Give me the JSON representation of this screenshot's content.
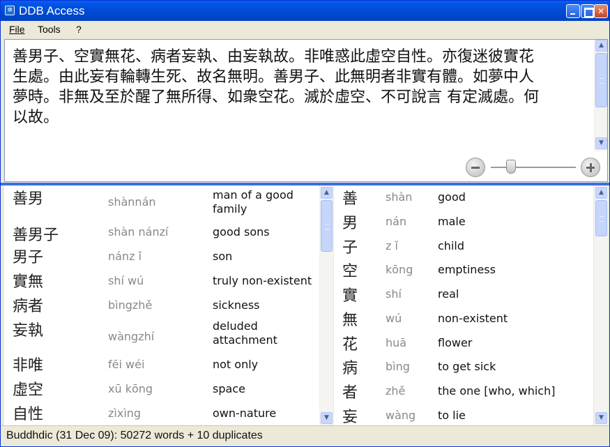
{
  "window": {
    "title": "DDB Access"
  },
  "menu": {
    "file": "File",
    "tools": "Tools",
    "help": "?"
  },
  "text_panel": {
    "lines": [
      "善男子、空實無花、病者妄執、由妄執故。非唯惑此虛空自性。亦復迷彼實花",
      "生處。由此妄有輪轉生死、故名無明。善男子、此無明者非實有體。如夢中人",
      "夢時。非無及至於醒了無所得、如衆空花。滅於虛空、不可說言  有定滅處。何",
      "以故。"
    ]
  },
  "zoom": {
    "level": 0.2
  },
  "left_list": [
    {
      "word": "善男",
      "pinyin": "shànnán",
      "english": "man of a good family"
    },
    {
      "word": "善男子",
      "pinyin": "shàn nánzí",
      "english": "good sons"
    },
    {
      "word": "男子",
      "pinyin": "nánz ǐ",
      "english": "son"
    },
    {
      "word": "實無",
      "pinyin": "shí wú",
      "english": "truly non-existent"
    },
    {
      "word": "病者",
      "pinyin": "bìngzhě",
      "english": "sickness"
    },
    {
      "word": "妄執",
      "pinyin": "wàngzhí",
      "english": "deluded attachment"
    },
    {
      "word": "非唯",
      "pinyin": "fēi wéi",
      "english": "not only"
    },
    {
      "word": "虛空",
      "pinyin": "xū kōng",
      "english": "space"
    },
    {
      "word": "自性",
      "pinyin": "zìxìng",
      "english": "own-nature"
    }
  ],
  "right_list": [
    {
      "word": "善",
      "pinyin": "shàn",
      "english": "good"
    },
    {
      "word": "男",
      "pinyin": "nán",
      "english": "male"
    },
    {
      "word": "子",
      "pinyin": "z ǐ",
      "english": "child"
    },
    {
      "word": "空",
      "pinyin": "kōng",
      "english": "emptiness"
    },
    {
      "word": "實",
      "pinyin": "shí",
      "english": "real"
    },
    {
      "word": "無",
      "pinyin": "wú",
      "english": "non-existent"
    },
    {
      "word": "花",
      "pinyin": "huā",
      "english": "flower"
    },
    {
      "word": "病",
      "pinyin": "bìng",
      "english": "to get sick"
    },
    {
      "word": "者",
      "pinyin": "zhě",
      "english": "the one [who, which]"
    },
    {
      "word": "妄",
      "pinyin": "wàng",
      "english": "to lie"
    }
  ],
  "status": {
    "text": "Buddhdic (31 Dec 09): 50272 words + 10 duplicates"
  },
  "icons": {
    "app": "gear-icon",
    "minimize": "minimize-icon",
    "maximize": "maximize-icon",
    "close": "close-icon",
    "zoom_out": "minus-circle-icon",
    "zoom_in": "plus-circle-icon",
    "scroll_up": "arrow-up-icon",
    "scroll_down": "arrow-down-icon"
  },
  "colors": {
    "titlebar": "#0054e3",
    "splitter": "#3a6ee8",
    "pinyin": "#888888"
  }
}
